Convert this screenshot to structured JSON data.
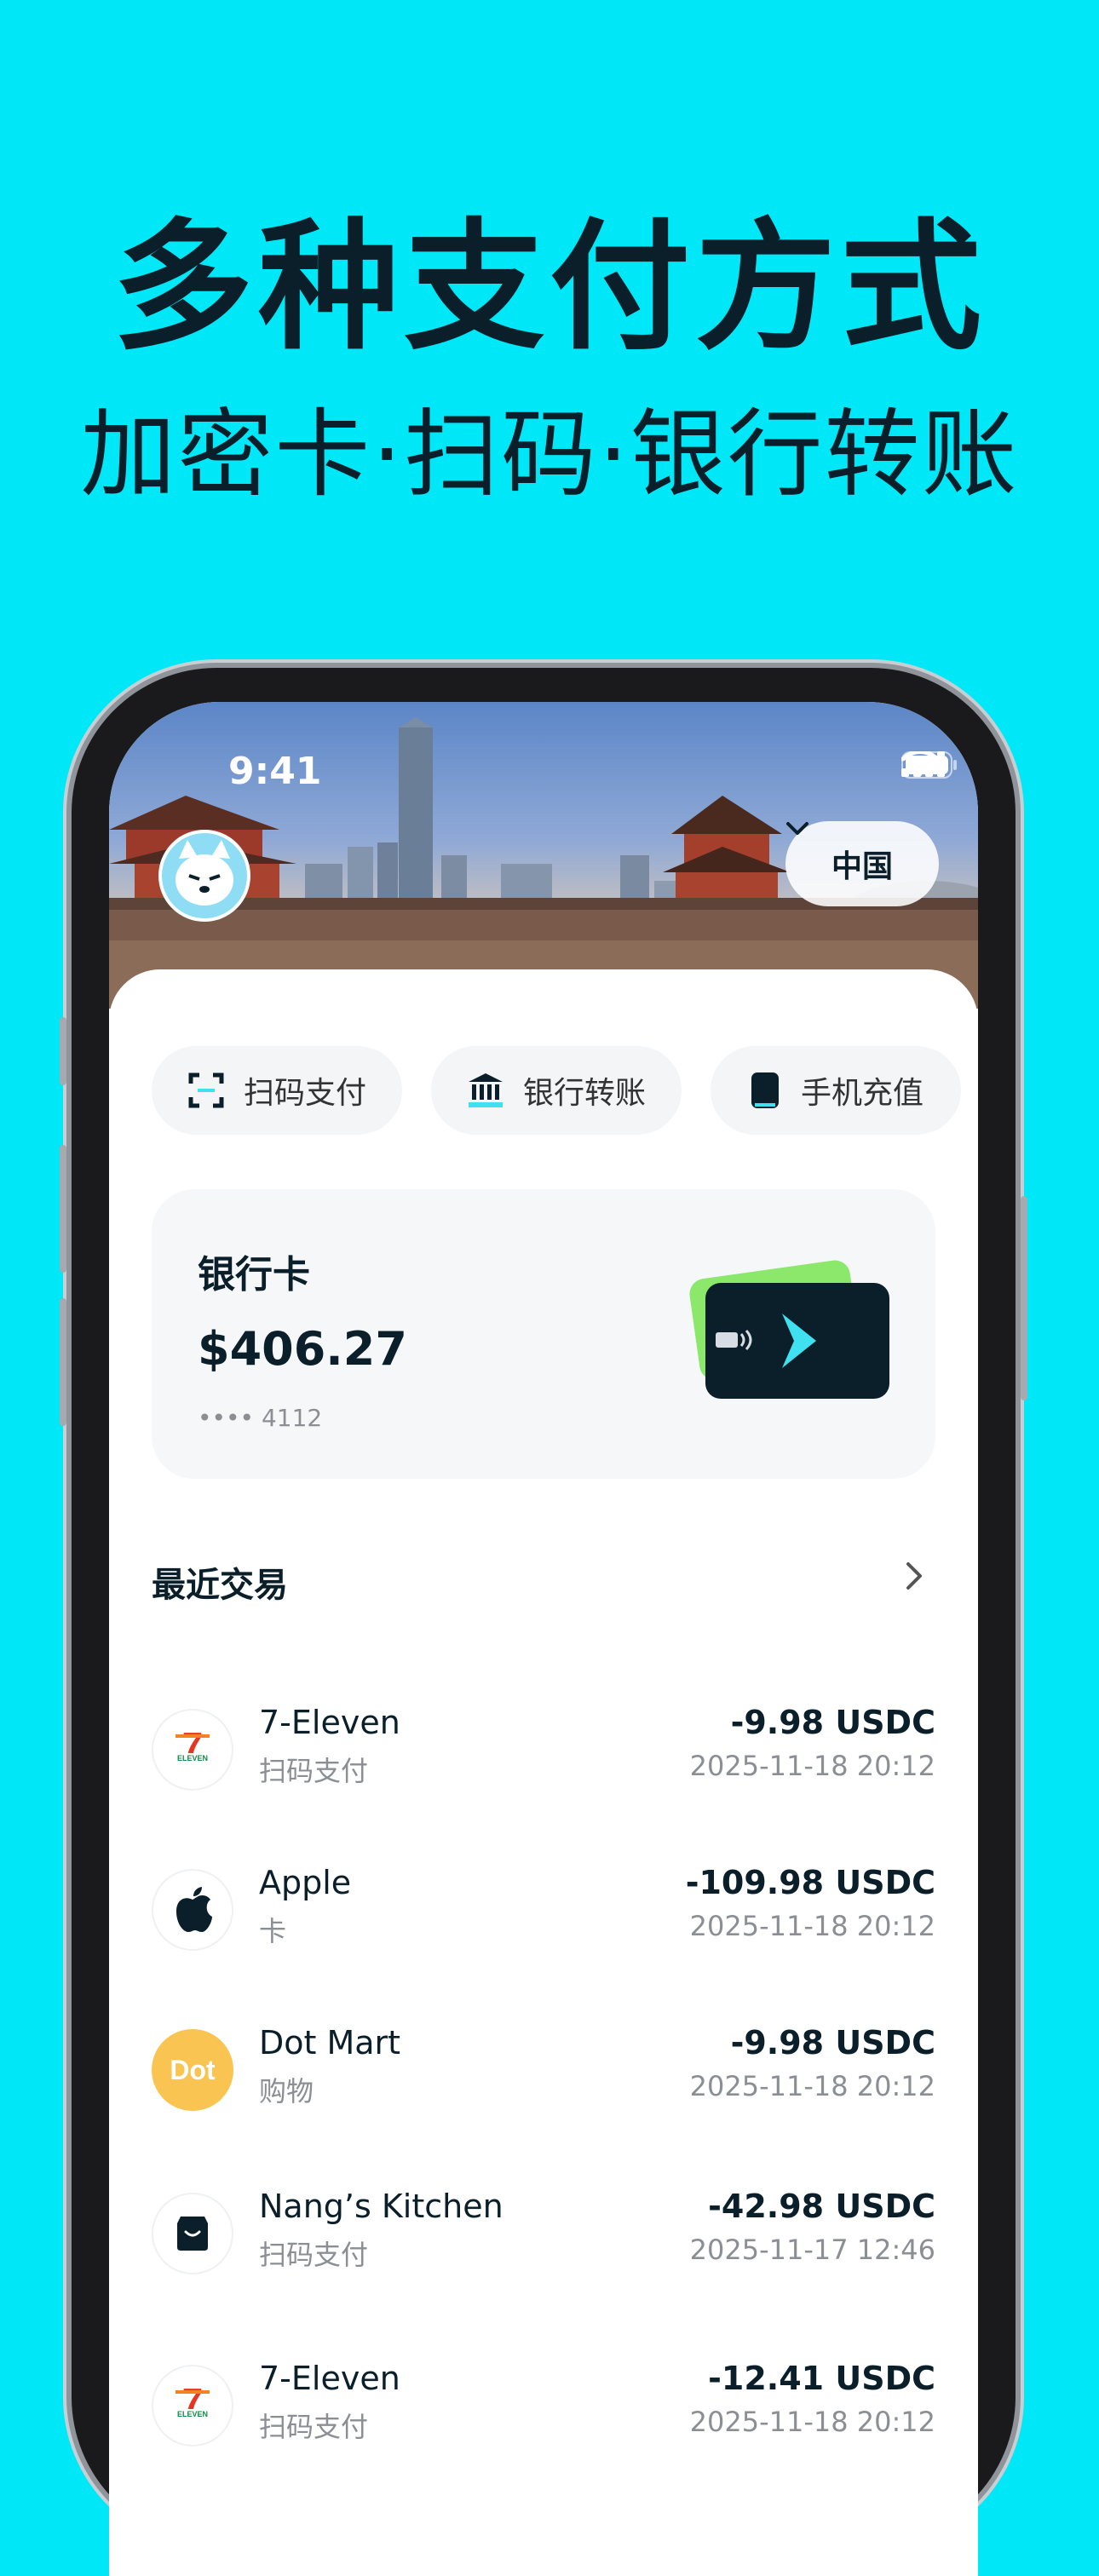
{
  "headline": "多种支付方式",
  "subheadline": "加密卡·扫码·银行转账",
  "status_bar": {
    "time": "9:41"
  },
  "region": {
    "label": "中国"
  },
  "quick_actions": [
    {
      "label": "扫码支付",
      "icon": "scan-icon"
    },
    {
      "label": "银行转账",
      "icon": "bank-icon"
    },
    {
      "label": "手机充值",
      "icon": "phone-icon"
    }
  ],
  "card": {
    "title": "银行卡",
    "balance": "$406.27",
    "number": "•••• 4112"
  },
  "recent": {
    "title": "最近交易",
    "transactions": [
      {
        "merchant": "7-Eleven",
        "category": "扫码支付",
        "amount": "-9.98 USDC",
        "time": "2025-11-18 20:12",
        "logo": "seven-eleven-logo"
      },
      {
        "merchant": "Apple",
        "category": "卡",
        "amount": "-109.98 USDC",
        "time": "2025-11-18 20:12",
        "logo": "apple-logo"
      },
      {
        "merchant": "Dot Mart",
        "category": "购物",
        "amount": "-9.98 USDC",
        "time": "2025-11-18 20:12",
        "logo": "dot-mart-logo"
      },
      {
        "merchant": "Nang’s Kitchen",
        "category": "扫码支付",
        "amount": "-42.98 USDC",
        "time": "2025-11-17 12:46",
        "logo": "store-icon"
      },
      {
        "merchant": "7-Eleven",
        "category": "扫码支付",
        "amount": "-12.41 USDC",
        "time": "2025-11-18 20:12",
        "logo": "seven-eleven-logo"
      }
    ]
  },
  "colors": {
    "background": "#00E8F7",
    "text": "#0B1F2A",
    "card_dark": "#0B1F2A",
    "accent_cyan": "#3FE0F0",
    "accent_green": "#8BE86A"
  }
}
